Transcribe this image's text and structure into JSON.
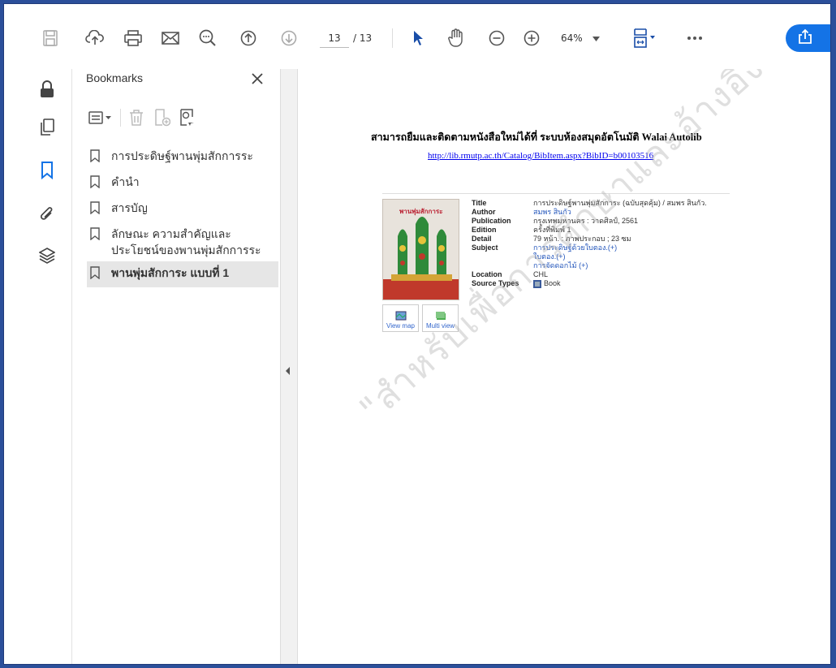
{
  "toolbar": {
    "page_current": "13",
    "page_total": "/ 13",
    "zoom": "64%",
    "icons": [
      "save-icon",
      "upload-icon",
      "print-icon",
      "email-icon",
      "search-icon",
      "page-up-icon",
      "page-down-icon",
      "select-cursor-icon",
      "hand-icon",
      "zoom-out-icon",
      "zoom-in-icon",
      "fit-page-icon",
      "more-icon",
      "share-icon"
    ]
  },
  "panel": {
    "title": "Bookmarks",
    "bookmarks": [
      {
        "label": "การประดิษฐ์พานพุ่มสักการระ"
      },
      {
        "label": "คำนำ"
      },
      {
        "label": "สารบัญ"
      },
      {
        "label": "ลักษณะ ความสำคัญและประโยชน์ของพานพุ่มสักการระ"
      },
      {
        "label": "พานพุ่มสักการะ แบบที่ 1"
      }
    ]
  },
  "document": {
    "heading": "สามารถยืมและติดตามหนังสือใหม่ได้ที่ ระบบห้องสมุดอัตโนมัติ Walai Autolib",
    "link": "http://lib.rmutp.ac.th/Catalog/BibItem.aspx?BibID=b00103516",
    "cover_title": "พานพุ่มสักการะ",
    "thumbs": [
      "View map",
      "Multi view"
    ],
    "fields": [
      {
        "label": "Title",
        "value": "การประดิษฐ์พานพุ่มสักการะ (ฉบับสุดคุ้ม) / สมพร สินกัว."
      },
      {
        "label": "Author",
        "value": "สมพร สินกัว"
      },
      {
        "label": "Publication",
        "value": "กรุงเทพมหานคร : วาดศิลป์, 2561"
      },
      {
        "label": "Edition",
        "value": "ครั้งที่พิมพ์ 1"
      },
      {
        "label": "Detail",
        "value": "79 หน้า. : ภาพประกอบ ; 23 ซม"
      },
      {
        "label": "Subject",
        "value": "การประดิษฐ์ด้วยใบตอง.(+)"
      },
      {
        "label": "",
        "value": "ใบตอง.(+)"
      },
      {
        "label": "",
        "value": "การจัดดอกไม้ (+)"
      },
      {
        "label": "Location",
        "value": "CHL"
      },
      {
        "label": "Source Types",
        "value": "Book"
      }
    ],
    "watermark": "\"สำหรับเพื่อการศึกษาและอ้างอิงเท่านั้น\""
  },
  "colors": {
    "accent": "#1473e6",
    "frame": "#2b4f9a"
  }
}
